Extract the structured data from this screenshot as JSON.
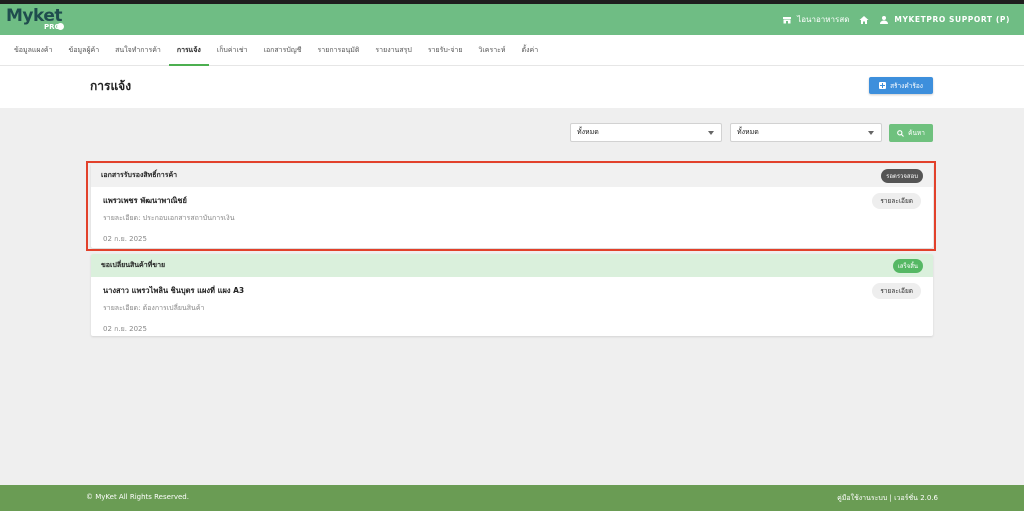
{
  "app": {
    "logo_text": "Myket",
    "logo_sub": "PRO"
  },
  "header": {
    "shop_link": "ไอนาอาหารสด",
    "user_name": "MYKETPRO SUPPORT (P)"
  },
  "nav": {
    "tabs": [
      {
        "label": "ข้อมูลแผงค้า"
      },
      {
        "label": "ข้อมูลผู้ค้า"
      },
      {
        "label": "สนใจทำการค้า"
      },
      {
        "label": "การแจ้ง"
      },
      {
        "label": "เก็บค่าเช่า"
      },
      {
        "label": "เอกสารบัญชี"
      },
      {
        "label": "รายการอนุมัติ"
      },
      {
        "label": "รายงานสรุป"
      },
      {
        "label": "รายรับ-จ่าย"
      },
      {
        "label": "วิเคราะห์"
      },
      {
        "label": "ตั้งค่า"
      }
    ],
    "active_index": 3
  },
  "page": {
    "title": "การแจ้ง",
    "create_button": "สร้างคำร้อง"
  },
  "filters": {
    "select1_value": "ทั้งหมด",
    "select2_value": "ทั้งหมด",
    "search_button": "ค้นหา"
  },
  "cards": [
    {
      "title": "เอกสารรับรองสิทธิ์การค้า",
      "status": "รอตรวจสอบ",
      "name": "แพรวเพชร พัฒนาพาณิชย์",
      "detail": "รายละเอียด: ประกอบเอกสารสถาบันการเงิน",
      "date": "02 ก.ย. 2025",
      "detail_button": "รายละเอียด"
    },
    {
      "title": "ขอเปลี่ยนสินค้าที่ขาย",
      "status": "เสร็จสิ้น",
      "name": "นางสาว แพรวไพลิน ชินบุตร แผงที่ แผง A3",
      "detail": "รายละเอียด: ต้องการเปลี่ยนสินค้า",
      "date": "02 ก.ย. 2025",
      "detail_button": "รายละเอียด"
    }
  ],
  "footer": {
    "copyright": "© MyKet All Rights Reserved.",
    "manual_link": "คู่มือใช้งานระบบ",
    "separator": "|",
    "version": "เวอร์ชั่น 2.0.6"
  },
  "colors": {
    "header_bg": "#6fbd84",
    "footer_bg": "#6a9c54",
    "primary_button": "#3d8fdc",
    "search_button": "#6fc17e",
    "highlight_border": "#e2412b"
  },
  "icons": {
    "shop": "store-icon",
    "home": "home-icon",
    "user": "user-icon",
    "create": "plus-square-icon",
    "search": "search-icon"
  }
}
